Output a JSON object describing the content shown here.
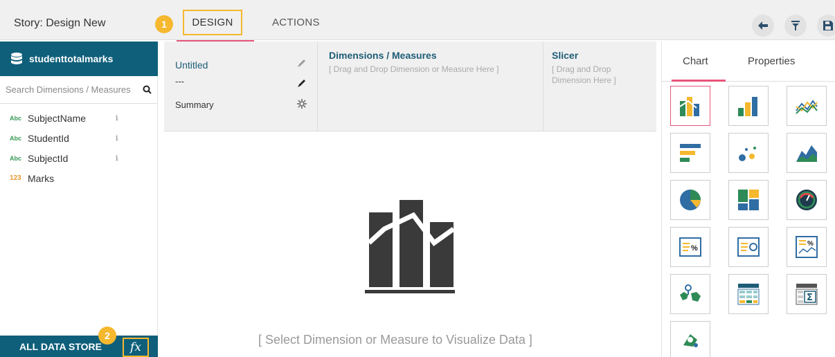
{
  "topbar": {
    "story_title": "Story: Design New",
    "badge1": "1",
    "tab_design": "DESIGN",
    "tab_actions": "ACTIONS",
    "buttons": [
      "back-arrow-icon",
      "filter-icon",
      "save-icon"
    ]
  },
  "sidebar": {
    "datastore_name": "studenttotalmarks",
    "search_placeholder": "Search Dimensions / Measures",
    "fields": [
      {
        "type": "Abc",
        "name": "SubjectName",
        "info": "i"
      },
      {
        "type": "Abc",
        "name": "StudentId",
        "info": "i"
      },
      {
        "type": "Abc",
        "name": "SubjectId",
        "info": "i"
      },
      {
        "type": "123",
        "name": "Marks",
        "info": ""
      }
    ],
    "footer_label": "ALL DATA STORE",
    "badge2": "2",
    "fx_label": "fx"
  },
  "config": {
    "title_label": "Untitled",
    "dash": "---",
    "summary_label": "Summary",
    "dimensions_title": "Dimensions / Measures",
    "dimensions_hint": "[ Drag and Drop Dimension or Measure Here ]",
    "slicer_title": "Slicer",
    "slicer_hint_1": "[ Drag and Drop",
    "slicer_hint_2": "Dimension Here ]"
  },
  "canvas": {
    "message": "[ Select Dimension or Measure to Visualize Data ]"
  },
  "panel": {
    "tab_chart": "Chart",
    "tab_properties": "Properties",
    "chart_types": [
      "overlapped-bar",
      "column",
      "line",
      "bar",
      "scatter",
      "area",
      "pie",
      "treemap",
      "gauge",
      "kpi-percent",
      "kpi-target",
      "kpi-trend",
      "map",
      "table",
      "pivot-table",
      "r-chart"
    ]
  },
  "colors": {
    "accent_pink": "#e8547a",
    "highlight_yellow": "#f5b82e",
    "datastore_blue": "#0f5f7a"
  }
}
